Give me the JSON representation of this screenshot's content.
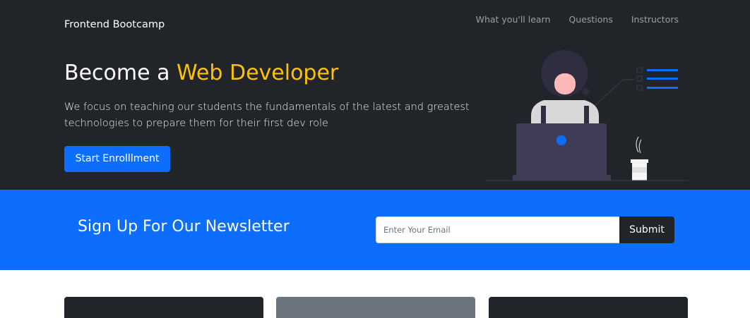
{
  "navbar": {
    "brand": "Frontend Bootcamp",
    "links": [
      {
        "label": "What you'll learn"
      },
      {
        "label": "Questions"
      },
      {
        "label": "Instructors"
      }
    ]
  },
  "hero": {
    "title_prefix": "Become a ",
    "title_accent": "Web Developer",
    "lead": "We focus on teaching our students the fundamentals of the latest and greatest technologies to prepare them for their first dev role",
    "cta_label": "Start Enrolllment"
  },
  "newsletter": {
    "title": "Sign Up For Our Newsletter",
    "email_placeholder": "Enter Your Email",
    "email_value": "",
    "submit_label": "Submit"
  },
  "colors": {
    "dark": "#212529",
    "primary": "#0d6efd",
    "warning": "#ffc107",
    "secondary": "#6c757d"
  }
}
